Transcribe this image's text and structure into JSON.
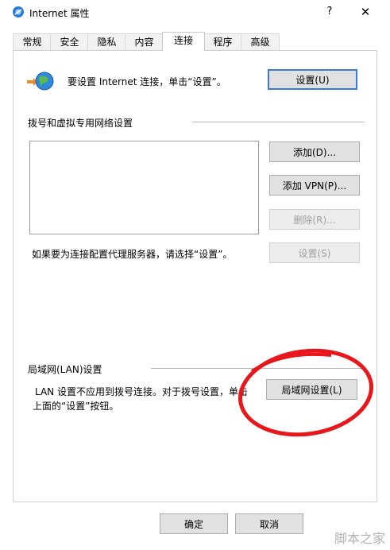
{
  "window": {
    "title": "Internet 属性",
    "help_label": "?",
    "close_label": "✕"
  },
  "tabs": [
    "常规",
    "安全",
    "隐私",
    "内容",
    "连接",
    "程序",
    "高级"
  ],
  "active_tab": "连接",
  "internet": {
    "setup_text": "要设置 Internet 连接，单击“设置”。",
    "setup_button": "设置(U)"
  },
  "dialup": {
    "heading": "拨号和虚拟专用网络设置",
    "add_button": "添加(D)...",
    "add_vpn_button": "添加 VPN(P)...",
    "remove_button": "删除(R)...",
    "settings_button": "设置(S)",
    "proxy_hint": "如果要为连接配置代理服务器，请选择“设置”。"
  },
  "lan": {
    "heading": "局域网(LAN)设置",
    "description_line1": "LAN 设置不应用到拨号连接。对于拨号设置，单击",
    "description_line2": "上面的“设置”按钮。",
    "lan_button": "局域网设置(L)"
  },
  "footer": {
    "ok_button": "确定",
    "cancel_button": "取消"
  },
  "watermark_text": "脚本之家",
  "annotation_color": "#e8171b"
}
